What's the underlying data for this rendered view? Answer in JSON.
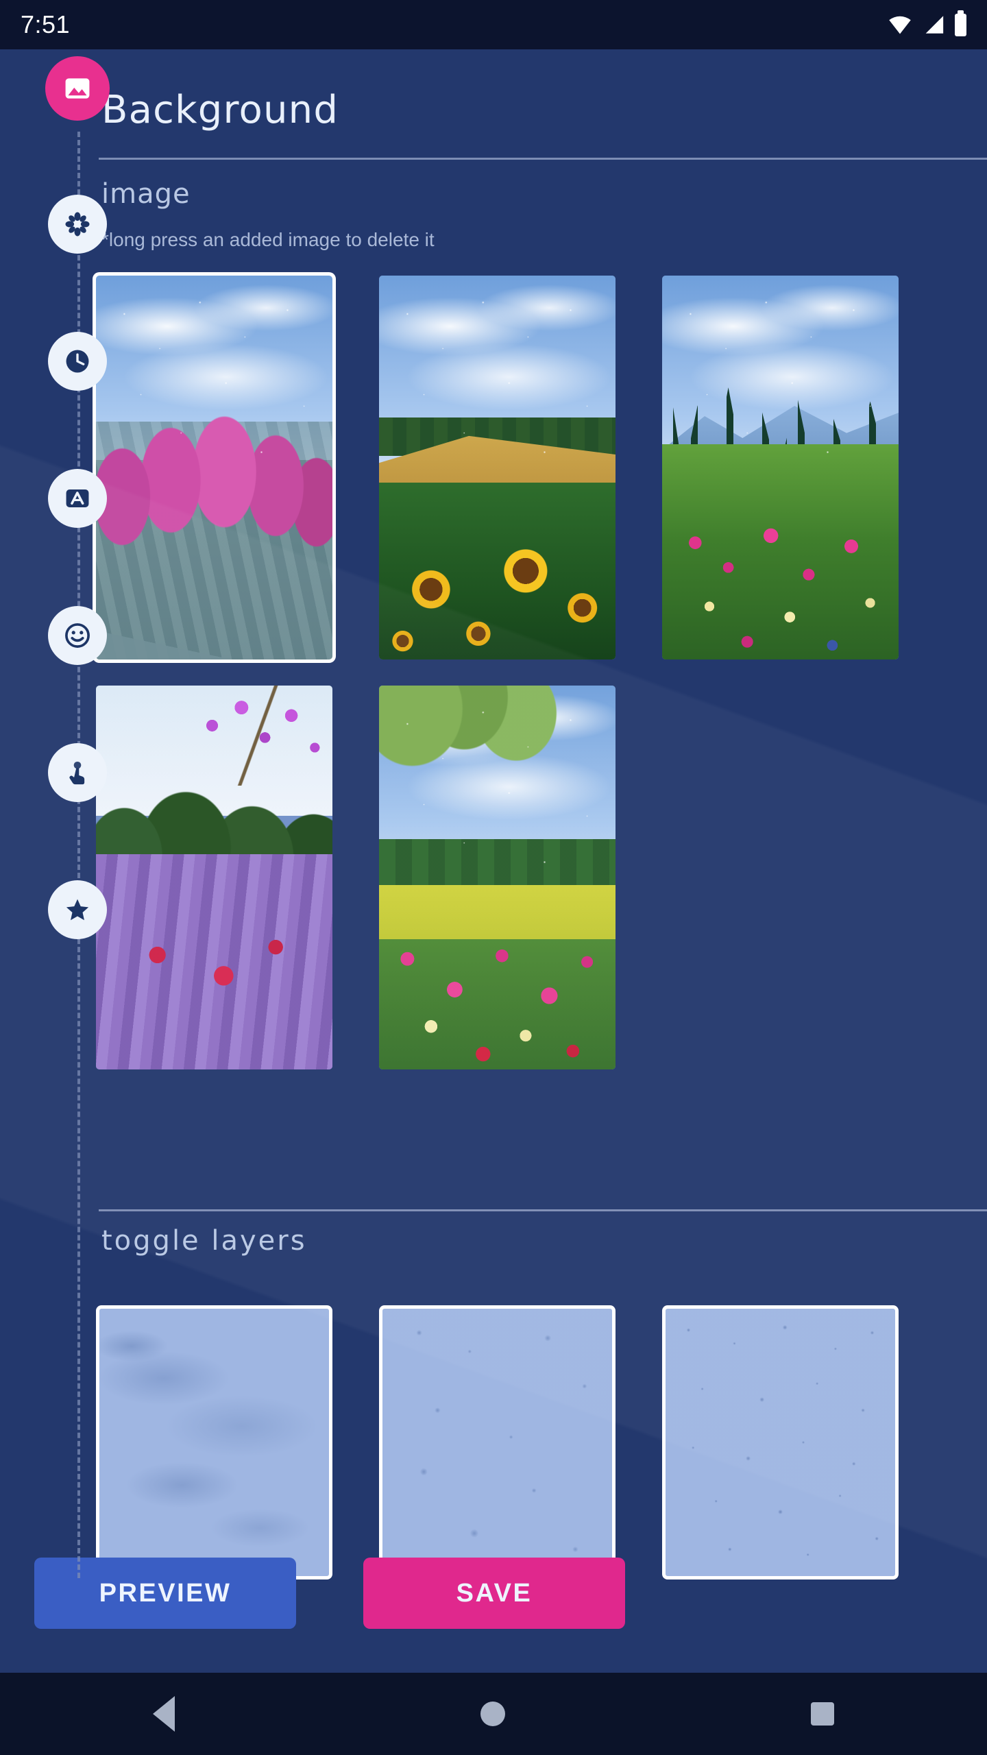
{
  "status_bar": {
    "time": "7:51",
    "icons": [
      "wifi-icon",
      "cellular-signal-icon",
      "battery-icon"
    ]
  },
  "header": {
    "title": "Background",
    "active_icon": "image-icon"
  },
  "sidebar": {
    "items": [
      {
        "icon": "image-icon",
        "name": "background",
        "active": true
      },
      {
        "icon": "flower-icon",
        "name": "effects",
        "active": false
      },
      {
        "icon": "clock-icon",
        "name": "clock",
        "active": false
      },
      {
        "icon": "font-a-icon",
        "name": "font",
        "active": false
      },
      {
        "icon": "smiley-icon",
        "name": "sticker",
        "active": false
      },
      {
        "icon": "touch-icon",
        "name": "touch",
        "active": false
      },
      {
        "icon": "star-icon",
        "name": "favourites",
        "active": false
      }
    ]
  },
  "sections": {
    "image": {
      "label": "image",
      "hint": "*long press an added image to delete it",
      "thumbnails": [
        {
          "name": "pink-tulips",
          "selected": true
        },
        {
          "name": "sunflower-field",
          "selected": false
        },
        {
          "name": "mountain-meadow",
          "selected": false
        },
        {
          "name": "lavender-poppies",
          "selected": false
        },
        {
          "name": "countryside-blooms",
          "selected": false
        }
      ]
    },
    "toggle_layers": {
      "label": "toggle layers",
      "cards": [
        {
          "name": "clouds-layer"
        },
        {
          "name": "raindrops-layer"
        },
        {
          "name": "stars-layer"
        }
      ]
    }
  },
  "actions": {
    "preview_label": "PREVIEW",
    "save_label": "SAVE"
  },
  "navbar": {
    "back": "back-icon",
    "home": "home-icon",
    "recents": "recents-icon"
  },
  "colors": {
    "background": "#23386d",
    "status_bar": "#0c142e",
    "accent_pink": "#e8308f",
    "accent_blue": "#3a5ec4",
    "save_pink": "#e0288d",
    "text_light": "#e9f0fb",
    "text_muted": "#b9c8e4"
  }
}
